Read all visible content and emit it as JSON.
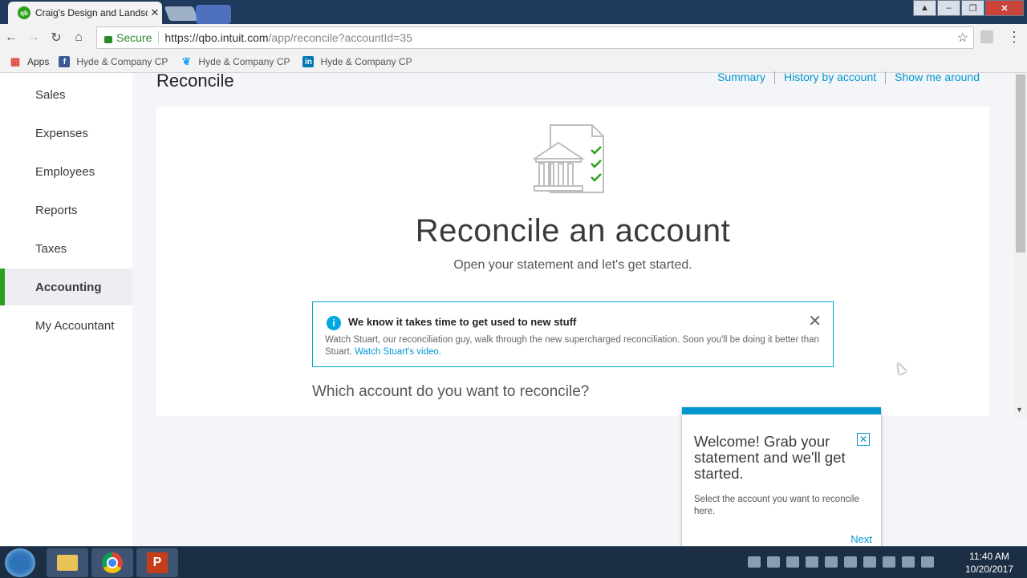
{
  "browser": {
    "tab_title": "Craig's Design and Landscaping",
    "tab_favicon": "qb",
    "secure_label": "Secure",
    "url_host": "https://qbo.intuit.com",
    "url_path": "/app/reconcile?accountId=35",
    "bookmarks": [
      {
        "label": "Apps",
        "icon": "apps-grid-icon"
      },
      {
        "label": "Hyde & Company CP",
        "icon": "facebook-icon"
      },
      {
        "label": "Hyde & Company CP",
        "icon": "twitter-icon"
      },
      {
        "label": "Hyde & Company CP",
        "icon": "linkedin-icon"
      }
    ]
  },
  "sidebar": {
    "items": [
      {
        "label": "Sales",
        "active": false
      },
      {
        "label": "Expenses",
        "active": false
      },
      {
        "label": "Employees",
        "active": false
      },
      {
        "label": "Reports",
        "active": false
      },
      {
        "label": "Taxes",
        "active": false
      },
      {
        "label": "Accounting",
        "active": true
      },
      {
        "label": "My Accountant",
        "active": false
      }
    ],
    "accent_color": "#2ca01c"
  },
  "page": {
    "title": "Reconcile",
    "links": {
      "summary": "Summary",
      "history": "History by account",
      "show_me": "Show me around"
    },
    "hero_title": "Reconcile an account",
    "hero_subtitle": "Open your statement and let's get started.",
    "notice": {
      "title": "We know it takes time to get used to new stuff",
      "body": "Watch Stuart, our reconciliation guy, walk through the new supercharged reconciliation. Soon you'll be doing it better than Stuart.",
      "link": "Watch Stuart's video."
    },
    "question": "Which account do you want to reconcile?"
  },
  "tooltip": {
    "title": "Welcome! Grab your statement and we'll get started.",
    "body": "Select the account you want to reconcile here.",
    "next": "Next",
    "accent_color": "#0097d1"
  },
  "taskbar": {
    "apps": [
      "file-explorer-icon",
      "chrome-icon",
      "powerpoint-icon"
    ],
    "time": "11:40 AM",
    "date": "10/20/2017"
  }
}
